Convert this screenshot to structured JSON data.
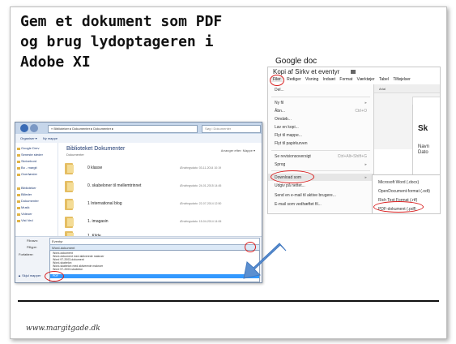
{
  "slide": {
    "title_lines": [
      "Gem et dokument som PDF",
      "og brug lydoptageren i",
      "Adobe XI"
    ],
    "google_doc_label": "Google doc",
    "footer": "www.margitgade.dk"
  },
  "google_doc": {
    "doc_title": "Kopi af Sirkv et eventyr",
    "menubar": [
      "Filer",
      "Rediger",
      "Visning",
      "Indsæt",
      "Format",
      "Værktøjer",
      "Tabel",
      "Tilføjelser"
    ],
    "file_menu": [
      {
        "label": "Del...",
        "shortcut": ""
      },
      {
        "label": "Ny fil",
        "shortcut": "▸"
      },
      {
        "label": "Åbn...",
        "shortcut": "Ctrl+O"
      },
      {
        "label": "Omdøb...",
        "shortcut": ""
      },
      {
        "label": "Lav en kopi...",
        "shortcut": ""
      },
      {
        "label": "Flyt til mappe...",
        "shortcut": ""
      },
      {
        "label": "Flyt til papirkurven",
        "shortcut": ""
      },
      {
        "label": "Se revisionsoversigt",
        "shortcut": "Ctrl+Alt+Shift+G"
      },
      {
        "label": "Sprog",
        "shortcut": "▸"
      },
      {
        "label": "Download som",
        "shortcut": "▸"
      },
      {
        "label": "Udgiv på nettet...",
        "shortcut": ""
      },
      {
        "label": "Send en e-mail til aktive brugere...",
        "shortcut": ""
      },
      {
        "label": "E-mail som vedhæftet fil...",
        "shortcut": ""
      }
    ],
    "toolbar_font": "Arial",
    "page_heading": "Sk",
    "page_line1": "Navn",
    "page_line2": "Dato",
    "download_submenu": [
      "Microsoft Word (.docx)",
      "OpenDocument-format (.odt)",
      "Rich Text Format (.rtf)",
      "PDF-dokument (.pdf)"
    ]
  },
  "save_dialog": {
    "breadcrumb": "« Biblioteker ▸ Dokumenter ▸ Dokumenter ▸",
    "search_placeholder": "Søg i Dokumenter",
    "toolbar": [
      "Organiser ▾",
      "Ny mappe"
    ],
    "nav_items": [
      "Google Drev",
      "Seneste steder",
      "Skrivebord",
      "Bo - margit",
      "Overførsler",
      "Biblioteker",
      "Billeder",
      "Dokumenter",
      "Musik",
      "Videoer",
      "Vist Ved"
    ],
    "library_title": "Biblioteket Dokumenter",
    "library_subtitle": "Dokumenter",
    "arrange_by": "Arranger efter:  Mappe ▾",
    "folders": [
      {
        "name": "0 klasse",
        "date": "Ændringsdato: 03-11-2014 10:19"
      },
      {
        "name": "0. skabeloner til mellemtrinnet",
        "date": "Ændringsdato: 24-01-2015 14:45"
      },
      {
        "name": "1 International blog",
        "date": "Ændringsdato: 22-07-2014 12:50"
      },
      {
        "name": "1. imagasin",
        "date": "Ændringsdato: 15-04-2014 14:06"
      },
      {
        "name": "1. Kilde",
        "date": ""
      }
    ],
    "filename_label": "Filnavn:",
    "filename_value": "Eventyr",
    "filetype_label": "Filtype:",
    "filetype_value": "Word-dokument",
    "authors_label": "Forfattere:",
    "type_options": [
      "Word-dokument",
      "Word-dokument med aktiverede makroer",
      "Word 97-2003-dokument",
      "Word-skabelon",
      "Word-skabelon med aktiverede makroer",
      "Word 97-2003-skabelon",
      "PDF"
    ],
    "hide_folders": "▲ Skjul mapper"
  }
}
